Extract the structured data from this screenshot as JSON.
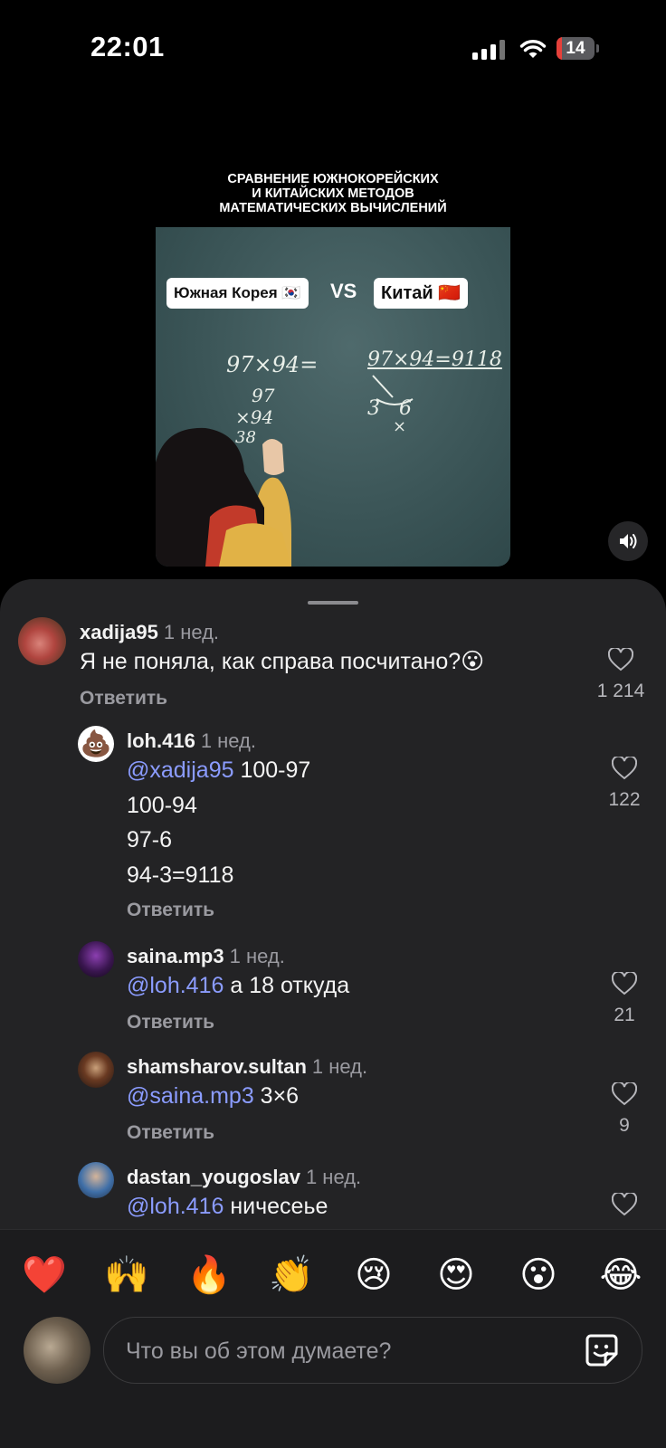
{
  "status_bar": {
    "time": "22:01",
    "battery_level": "14",
    "battery_fraction": 0.14
  },
  "video": {
    "caption_lines": [
      "СРАВНЕНИЕ ЮЖНОКОРЕЙСКИХ",
      "И КИТАЙСКИХ МЕТОДОВ",
      "МАТЕМАТИЧЕСКИХ ВЫЧИСЛЕНИЙ"
    ],
    "left_label": "Южная Корея 🇰🇷",
    "vs": "VS",
    "right_label": "Китай 🇨🇳",
    "chalk_left_problem": "97×94=",
    "chalk_left_top": "97",
    "chalk_left_mid": "×94",
    "chalk_left_bottom": "38",
    "chalk_right_problem": "97×94=9118",
    "chalk_right_work": "3   6",
    "chalk_right_x": "×",
    "sound_icon": "speaker-icon"
  },
  "comments": [
    {
      "user": "xadija95",
      "age": "1 нед.",
      "mention": "",
      "lines": [
        "Я не поняла, как справа посчитано?😮"
      ],
      "reply": "Ответить",
      "likes": "1 214"
    },
    {
      "user": "loh.416",
      "age": "1 нед.",
      "mention": "@xadija95",
      "lines": [
        " 100-97",
        "100-94",
        "97-6",
        "94-3=9118"
      ],
      "reply": "Ответить",
      "likes": "122"
    },
    {
      "user": "saina.mp3",
      "age": "1 нед.",
      "mention": "@loh.416",
      "lines": [
        " а 18 откуда"
      ],
      "reply": "Ответить",
      "likes": "21"
    },
    {
      "user": "shamsharov.sultan",
      "age": "1 нед.",
      "mention": "@saina.mp3",
      "lines": [
        " 3×6"
      ],
      "reply": "Ответить",
      "likes": "9"
    },
    {
      "user": "dastan_yougoslav",
      "age": "1 нед.",
      "mention": "@loh.416",
      "lines": [
        " ничесеье"
      ],
      "reply": "",
      "likes": ""
    }
  ],
  "reactions": [
    "❤️",
    "🙌",
    "🔥",
    "👏",
    "😢",
    "😍",
    "😮",
    "😂"
  ],
  "composer": {
    "placeholder": "Что вы об этом думаете?",
    "sticker_icon": "sticker-icon"
  }
}
